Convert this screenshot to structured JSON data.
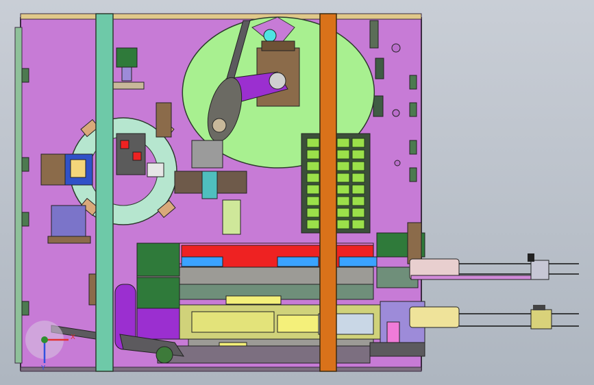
{
  "viewport": {
    "background_top": "#c9ced6",
    "background_bottom": "#aeb6c0"
  },
  "colors": {
    "frame_magenta": "#c77bd6",
    "frame_outline": "#3a2a40",
    "mint_rail": "#6ec9a8",
    "orange_rail": "#d9721a",
    "light_green": "#a8f090",
    "pale_teal": "#b6e6cf",
    "red": "#ee2222",
    "yellow": "#f4f07a",
    "olive": "#d0d27a",
    "purple": "#9b2fd0",
    "blue_bar": "#3aa3ff",
    "grey_metal": "#9c9b96",
    "dark_grey": "#5c5a5e",
    "brown": "#8b6b4a",
    "cyan": "#4fe3e3",
    "pink": "#f07bd8",
    "green_dark": "#2f7a3a",
    "lavender": "#9d8bd9"
  },
  "triad": {
    "x_label": "X",
    "y_label": "Y",
    "z_color": "#2f8f2f",
    "x_color": "#e23030",
    "y_color": "#3050e0"
  }
}
